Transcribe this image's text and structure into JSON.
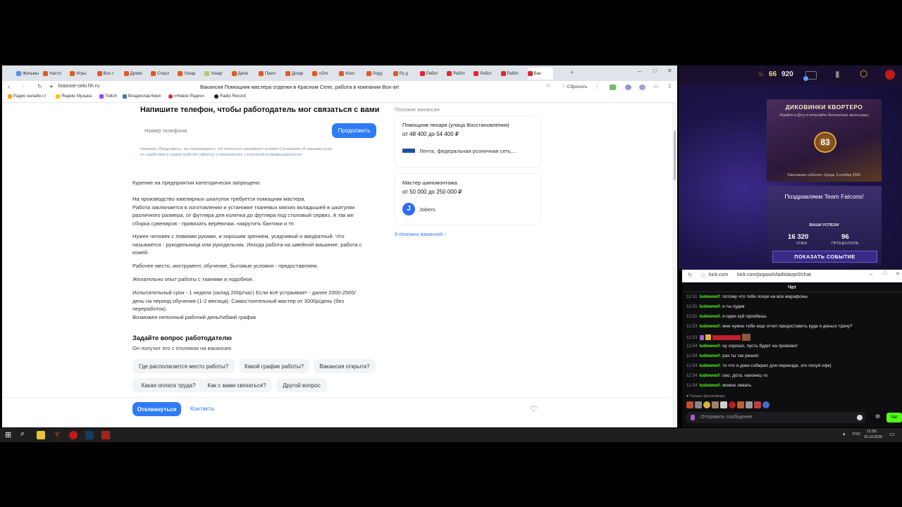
{
  "browser": {
    "tabs": [
      {
        "label": "Фильмы",
        "color": "#5b8def",
        "active": false
      },
      {
        "label": "Насто",
        "color": "#e25822",
        "active": false
      },
      {
        "label": "Игры",
        "color": "#e25822",
        "active": false
      },
      {
        "label": "Все т",
        "color": "#e25822",
        "active": false
      },
      {
        "label": "Древо",
        "color": "#e25822",
        "active": false
      },
      {
        "label": "Спасл",
        "color": "#e25822",
        "active": false
      },
      {
        "label": "Узнар",
        "color": "#e25822",
        "active": false
      },
      {
        "label": "Узнар",
        "color": "#a8d26b",
        "active": false
      },
      {
        "label": "Джон",
        "color": "#e25822",
        "active": false
      },
      {
        "label": "Пункт",
        "color": "#e25822",
        "active": false
      },
      {
        "label": "Дозур",
        "color": "#e25822",
        "active": false
      },
      {
        "label": "«Отк",
        "color": "#e25822",
        "active": false
      },
      {
        "label": "Коко",
        "color": "#e25822",
        "active": false
      },
      {
        "label": "Лоуд",
        "color": "#e25822",
        "active": false
      },
      {
        "label": "Ру д",
        "color": "#e25822",
        "active": false
      },
      {
        "label": "Работ",
        "color": "#e3262f",
        "active": false
      },
      {
        "label": "Работ",
        "color": "#e3262f",
        "active": false
      },
      {
        "label": "Работ",
        "color": "#e3262f",
        "active": false
      },
      {
        "label": "Работ",
        "color": "#e3262f",
        "active": false
      },
      {
        "label": "Вак",
        "color": "#e3262f",
        "active": true
      }
    ],
    "address": "krasnoe-selo.hh.ru",
    "page_title": "Вакансия Помощник мастера отделки в Красном Селе, работа в компании Box-art",
    "share_label": "Сбросить",
    "bookmarks": [
      "Радио онлайн ст",
      "Яндекс Музыка",
      "Twitch",
      "Владислав Кири",
      "«Новое Радио»",
      "Radio Record"
    ]
  },
  "page": {
    "phone_heading": "Напишите телефон, чтобы работодатель мог связаться с вами",
    "phone_placeholder": "Номер телефона",
    "continue_label": "Продолжить",
    "disclaimer_1": "Нажимая «Продолжить», вы подтверждаете, что полностью принимаете условия Соглашения об оказании услуг",
    "disclaimer_2": "по содействию в трудоустройстве (оферты) и ознакомились с политикой конфиденциальности",
    "description": [
      "Курение на предприятии категорически запрещено.",
      "На производство ювелирных шкатулок требуется помощник мастера.\nРабота заключается в изготовлении и установке тканевых мягких вкладышей в шкатулки\nразличного размера, от футляра для колечка до футляра под столовый сервиз. А так же\nсборка сувениров - привязать верёвочки, накрутить бантики и тп.",
      "Нужен человек с ловкими руками, и хорошим зрением, усидчивый и аккуратный. Что\nназывается - рукодельница или рукодельник. Иногда работа на швейной машинке, работа с\nкожей.",
      "Рабочее место, инструмент, обучение, бытовые условия - предоставляем.",
      "Желательно опыт работы с тканями и подобное.",
      "Испытательный срок - 1 неделя (оклад 200р/час) Если всё устраивает - далее 2000-2500/\nдень на период обучения (1-2 месяца). Самостоятельный мастер от 3000р/день (без\nпереработок).\nВозможен неполный рабочий день/гибкий график"
    ],
    "ask_heading": "Задайте вопрос работодателю",
    "ask_sub": "Он получит его с откликом на вакансию",
    "questions": [
      "Где располагается место работы?",
      "Какой график работы?",
      "Вакансия открыта?",
      "Какая оплата труда?",
      "Как с вами связаться?",
      "Другой вопрос"
    ],
    "respond_label": "Откликнуться",
    "contacts_label": "Контакты",
    "similar_heading": "Похожие вакансии",
    "similar": [
      {
        "title": "Помощник пекаря (улица Восстановления)",
        "salary": "от 48 400 до 54 400 ₽",
        "company": "Лента, федеральная розничная сеть,..."
      },
      {
        "title": "Мастер шиномонтажа",
        "salary": "от 50 000 до 250 000 ₽",
        "company": "Jobers"
      }
    ],
    "similar_more": "9 похожих вакансий"
  },
  "stream": {
    "counter_1": "66",
    "counter_2": "920",
    "promo1_title": "ДИКОВИНКИ КВОРТЕРО",
    "promo1_sub": "Играйте в Доту и получайте бесплатные аксессуары",
    "promo1_level": "83",
    "promo1_end": "Окончание события: Среда, 5 ноября 2025",
    "promo2_title": "Поздравляем Team Falcons!",
    "promo2_sub": "ВАШИ УСПЕХИ",
    "points_value": "16 320",
    "points_label": "ОЧКИ",
    "percent_value": "96",
    "percent_label": "ПРОЦЕНТИЛЬ",
    "show_event": "ПОКАЗАТЬ СОБЫТИЕ"
  },
  "chat": {
    "domain": "kick.com",
    "url": "kick.com/popout/vladislavpr0/chat",
    "title": "Чат",
    "messages": [
      {
        "time": "11:51",
        "user": "ludowoof:",
        "text": "потому что тебе похуи на все марафоны"
      },
      {
        "time": "11:51",
        "user": "ludowoof:",
        "text": "и ты лудик"
      },
      {
        "time": "11:51",
        "user": "ludowoof:",
        "text": "и один хуй проебешь"
      },
      {
        "time": "11:53",
        "user": "ludowoof:",
        "text": "мне нужно тебе еще отчет предоставить куда я деньги трачу?"
      },
      {
        "time": "11:53",
        "user": "",
        "text": ""
      },
      {
        "time": "11:54",
        "user": "ludowoof:",
        "text": "ну хорошо, пусть будет на провиант"
      },
      {
        "time": "11:54",
        "user": "ludowoof:",
        "text": "раз ты так решил"
      },
      {
        "time": "11:54",
        "user": "ludowoof:",
        "text": "то что я доки собирал для переезда, это похуй офк)"
      },
      {
        "time": "11:54",
        "user": "ludowoof:",
        "text": "ооо, дота, наконец-то"
      },
      {
        "time": "11:54",
        "user": "ludowoof:",
        "text": "можно ливать"
      }
    ],
    "followers_only": "Только фолловеры",
    "send_placeholder": "Отправить сообщение",
    "chat_button": "Чат"
  },
  "taskbar": {
    "lang": "РУС",
    "time": "11:55",
    "date": "15.10.2025"
  }
}
